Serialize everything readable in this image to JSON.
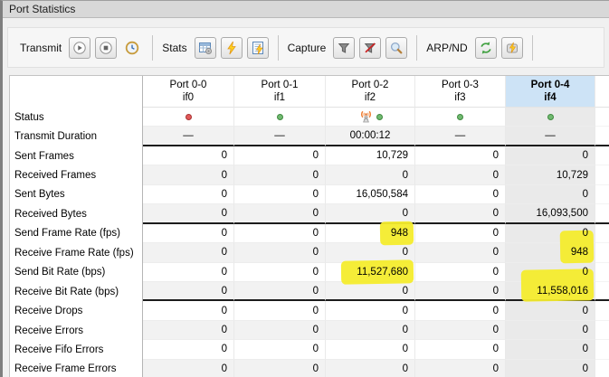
{
  "window": {
    "title": "Port Statistics"
  },
  "toolbar": {
    "groups": [
      {
        "label": "Transmit",
        "buttons": [
          {
            "icon": "play",
            "name": "transmit-start-button"
          },
          {
            "icon": "stop",
            "name": "transmit-stop-button"
          },
          {
            "icon": "clock",
            "name": "transmit-timer-button",
            "flat": true
          }
        ]
      },
      {
        "label": "Stats",
        "buttons": [
          {
            "icon": "stats-grid",
            "name": "stats-config-button"
          },
          {
            "icon": "lightning",
            "name": "stats-clear-button"
          },
          {
            "icon": "doc-lightning",
            "name": "stats-clear-log-button"
          }
        ]
      },
      {
        "label": "Capture",
        "buttons": [
          {
            "icon": "funnel",
            "name": "capture-start-button"
          },
          {
            "icon": "funnel-clear",
            "name": "capture-stop-button"
          },
          {
            "icon": "magnifier",
            "name": "capture-view-button"
          }
        ]
      },
      {
        "label": "ARP/ND",
        "buttons": [
          {
            "icon": "refresh",
            "name": "arp-refresh-button"
          },
          {
            "icon": "db-lightning",
            "name": "arp-clear-button"
          }
        ]
      }
    ]
  },
  "table": {
    "columns": [
      {
        "title": "Port 0-0",
        "subtitle": "if0",
        "selected": false
      },
      {
        "title": "Port 0-1",
        "subtitle": "if1",
        "selected": false
      },
      {
        "title": "Port 0-2",
        "subtitle": "if2",
        "selected": false
      },
      {
        "title": "Port 0-3",
        "subtitle": "if3",
        "selected": false
      },
      {
        "title": "Port 0-4",
        "subtitle": "if4",
        "selected": true
      }
    ],
    "rows": [
      {
        "label": "Status",
        "type": "status",
        "cells": [
          [
            "red-dot"
          ],
          [
            "green-dot"
          ],
          [
            "antenna",
            "green-dot"
          ],
          [
            "green-dot"
          ],
          [
            "green-dot"
          ]
        ]
      },
      {
        "label": "Transmit Duration",
        "type": "center",
        "cells": [
          "—",
          "—",
          "00:00:12",
          "—",
          "—"
        ],
        "thick_below": true
      },
      {
        "label": "Sent Frames",
        "cells": [
          "0",
          "0",
          "10,729",
          "0",
          "0"
        ]
      },
      {
        "label": "Received Frames",
        "cells": [
          "0",
          "0",
          "0",
          "0",
          "10,729"
        ]
      },
      {
        "label": "Sent Bytes",
        "cells": [
          "0",
          "0",
          "16,050,584",
          "0",
          "0"
        ]
      },
      {
        "label": "Received Bytes",
        "cells": [
          "0",
          "0",
          "0",
          "0",
          "16,093,500"
        ],
        "thick_below": true
      },
      {
        "label": "Send Frame Rate (fps)",
        "cells": [
          "0",
          "0",
          "948",
          "0",
          "0"
        ],
        "highlights": [
          2
        ]
      },
      {
        "label": "Receive Frame Rate (fps)",
        "cells": [
          "0",
          "0",
          "0",
          "0",
          "948"
        ],
        "highlights": [
          4
        ],
        "tall": true
      },
      {
        "label": "Send Bit Rate (bps)",
        "cells": [
          "0",
          "0",
          "11,527,680",
          "0",
          "0"
        ],
        "highlights": [
          2
        ]
      },
      {
        "label": "Receive Bit Rate (bps)",
        "cells": [
          "0",
          "0",
          "0",
          "0",
          "11,558,016"
        ],
        "highlights": [
          4
        ],
        "tall": true,
        "thick_below": true
      },
      {
        "label": "Receive Drops",
        "cells": [
          "0",
          "0",
          "0",
          "0",
          "0"
        ]
      },
      {
        "label": "Receive Errors",
        "cells": [
          "0",
          "0",
          "0",
          "0",
          "0"
        ]
      },
      {
        "label": "Receive Fifo Errors",
        "cells": [
          "0",
          "0",
          "0",
          "0",
          "0"
        ]
      },
      {
        "label": "Receive Frame Errors",
        "cells": [
          "0",
          "0",
          "0",
          "0",
          "0"
        ]
      }
    ]
  },
  "colors": {
    "selected_header": "#cde3f6",
    "selected_column": "#eaeaea",
    "highlight": "#f4ec2d",
    "stripe": "#f2f2f2",
    "status_up": "#71b971",
    "status_down": "#e25a5a"
  }
}
